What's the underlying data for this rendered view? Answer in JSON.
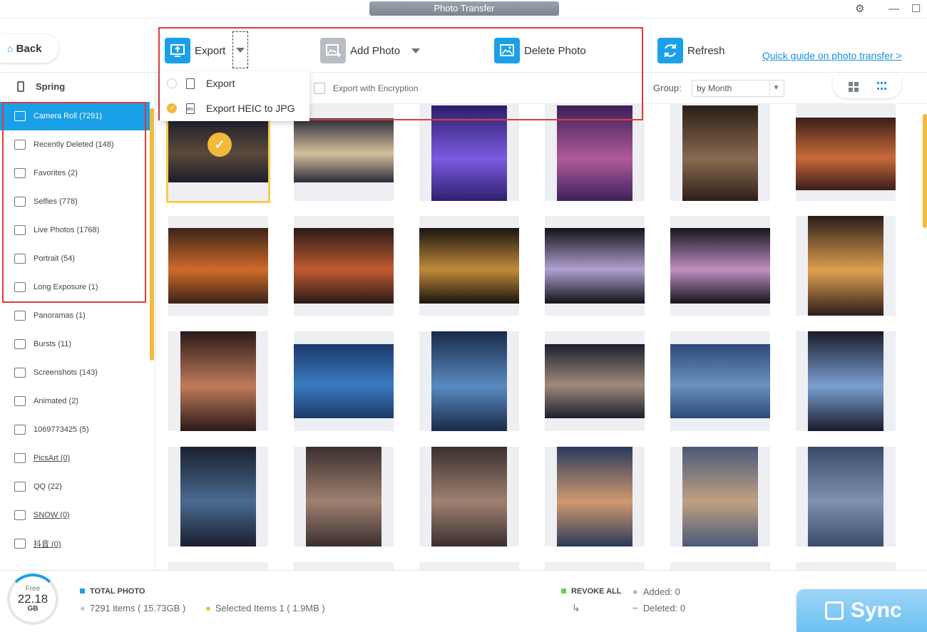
{
  "window": {
    "title": "Photo Transfer"
  },
  "toolbar": {
    "back_label": "Back",
    "export_label": "Export",
    "add_photo_label": "Add Photo",
    "delete_photo_label": "Delete Photo",
    "refresh_label": "Refresh",
    "guide_link": "Quick guide on photo transfer >"
  },
  "export_menu": {
    "items": [
      {
        "label": "Export",
        "selected": false
      },
      {
        "label": "Export HEIC to JPG",
        "selected": true
      }
    ]
  },
  "subbar": {
    "encryption_label": "Export with Encryption",
    "group_label": "Group:",
    "group_value": "by Month"
  },
  "sidebar": {
    "device_name": "Spring",
    "items": [
      {
        "label": "Camera Roll (7291)",
        "icon": "camera-icon",
        "active": true
      },
      {
        "label": "Recently Deleted (148)",
        "icon": "trash-icon"
      },
      {
        "label": "Favorites (2)",
        "icon": "heart-icon"
      },
      {
        "label": "Selfies (778)",
        "icon": "person-icon"
      },
      {
        "label": "Live Photos (1768)",
        "icon": "live-photo-icon"
      },
      {
        "label": "Portrait (54)",
        "icon": "cube-icon"
      },
      {
        "label": "Long Exposure (1)",
        "icon": "long-exposure-icon"
      },
      {
        "label": "Panoramas (1)",
        "icon": "panorama-icon"
      },
      {
        "label": "Bursts (11)",
        "icon": "bursts-icon"
      },
      {
        "label": "Screenshots (143)",
        "icon": "screenshot-icon"
      },
      {
        "label": "Animated (2)",
        "icon": "animated-icon"
      },
      {
        "label": "1069773425 (5)",
        "icon": "album-icon"
      },
      {
        "label": "PicsArt (0)",
        "icon": "album-icon"
      },
      {
        "label": "QQ (22)",
        "icon": "album-icon"
      },
      {
        "label": "SNOW (0)",
        "icon": "album-icon"
      },
      {
        "label": "抖音 (0)",
        "icon": "album-icon"
      }
    ]
  },
  "footer": {
    "free_label": "Free",
    "free_value": "22.18",
    "free_unit": "GB",
    "total_title": "TOTAL PHOTO",
    "total_items": "7291 items ( 15.73GB )",
    "selected_items": "Selected Items 1 ( 1.9MB )",
    "revoke_label": "REVOKE ALL",
    "added": "Added: 0",
    "deleted": "Deleted: 0",
    "sync_label": "Sync"
  },
  "colors": {
    "accent": "#1aa0e8",
    "selection": "#f2b93a",
    "highlight_box": "#e03a3a"
  }
}
